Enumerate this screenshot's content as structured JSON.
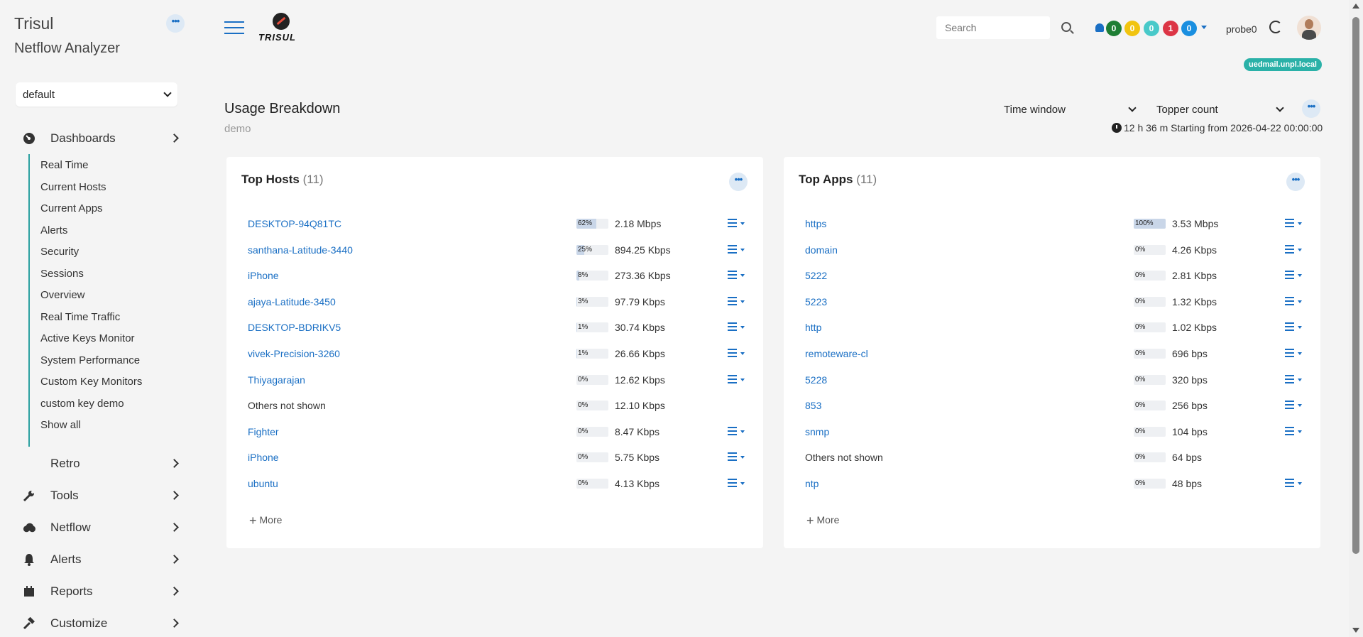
{
  "sidebar": {
    "brand": "Trisul",
    "subtitle": "Netflow Analyzer",
    "profile": "default",
    "nav": {
      "dashboards": {
        "label": "Dashboards",
        "icon": "dashboard-gauge-icon"
      },
      "retro": {
        "label": "Retro"
      },
      "tools": {
        "label": "Tools",
        "icon": "wrench-icon"
      },
      "netflow": {
        "label": "Netflow",
        "icon": "cloud-icon"
      },
      "alerts": {
        "label": "Alerts",
        "icon": "bell-icon"
      },
      "reports": {
        "label": "Reports",
        "icon": "calendar-icon"
      },
      "customize": {
        "label": "Customize",
        "icon": "hammer-icon"
      }
    },
    "dashboard_items": [
      "Real Time",
      "Current Hosts",
      "Current Apps",
      "Alerts",
      "Security",
      "Sessions",
      "Overview",
      "Real Time Traffic",
      "Active Keys Monitor",
      "System Performance",
      "Custom Key Monitors",
      "custom key demo",
      "Show all"
    ]
  },
  "header": {
    "logo_text": "TRISUL",
    "search_placeholder": "Search",
    "badges": [
      "0",
      "0",
      "0",
      "1",
      "0"
    ],
    "badge_colors": [
      "#1e7e34",
      "#f1c40f",
      "#48c9c9",
      "#dc3545",
      "#1a8fe0"
    ],
    "probe": "probe0",
    "host": "uedmail.unpl.local"
  },
  "page": {
    "title": "Usage Breakdown",
    "subtitle": "demo",
    "time_window_label": "Time window",
    "topper_count_label": "Topper count",
    "time_info": "12 h 36 m Starting from 2026-04-22 00:00:00"
  },
  "top_hosts": {
    "title": "Top Hosts",
    "count": "(11)",
    "more_label": "More",
    "rows": [
      {
        "name": "DESKTOP-94Q81TC",
        "pct": "62%",
        "fill": 0.62,
        "value": "2.18 Mbps",
        "link": true
      },
      {
        "name": "santhana-Latitude-3440",
        "pct": "25%",
        "fill": 0.25,
        "value": "894.25 Kbps",
        "link": true
      },
      {
        "name": "iPhone",
        "pct": "8%",
        "fill": 0.08,
        "value": "273.36 Kbps",
        "link": true
      },
      {
        "name": "ajaya-Latitude-3450",
        "pct": "3%",
        "fill": 0.03,
        "value": "97.79 Kbps",
        "link": true
      },
      {
        "name": "DESKTOP-BDRIKV5",
        "pct": "1%",
        "fill": 0.01,
        "value": "30.74 Kbps",
        "link": true
      },
      {
        "name": "vivek-Precision-3260",
        "pct": "1%",
        "fill": 0.01,
        "value": "26.66 Kbps",
        "link": true
      },
      {
        "name": "Thiyagarajan",
        "pct": "0%",
        "fill": 0.0,
        "value": "12.62 Kbps",
        "link": true
      },
      {
        "name": "Others not shown",
        "pct": "0%",
        "fill": 0.0,
        "value": "12.10 Kbps",
        "link": false
      },
      {
        "name": "Fighter",
        "pct": "0%",
        "fill": 0.0,
        "value": "8.47 Kbps",
        "link": true
      },
      {
        "name": "iPhone",
        "pct": "0%",
        "fill": 0.0,
        "value": "5.75 Kbps",
        "link": true
      },
      {
        "name": "ubuntu",
        "pct": "0%",
        "fill": 0.0,
        "value": "4.13 Kbps",
        "link": true
      }
    ]
  },
  "top_apps": {
    "title": "Top Apps",
    "count": "(11)",
    "more_label": "More",
    "rows": [
      {
        "name": "https",
        "pct": "100%",
        "fill": 1.0,
        "value": "3.53 Mbps",
        "link": true
      },
      {
        "name": "domain",
        "pct": "0%",
        "fill": 0.0,
        "value": "4.26 Kbps",
        "link": true
      },
      {
        "name": "5222",
        "pct": "0%",
        "fill": 0.0,
        "value": "2.81 Kbps",
        "link": true
      },
      {
        "name": "5223",
        "pct": "0%",
        "fill": 0.0,
        "value": "1.32 Kbps",
        "link": true
      },
      {
        "name": "http",
        "pct": "0%",
        "fill": 0.0,
        "value": "1.02 Kbps",
        "link": true
      },
      {
        "name": "remoteware-cl",
        "pct": "0%",
        "fill": 0.0,
        "value": "696 bps",
        "link": true
      },
      {
        "name": "5228",
        "pct": "0%",
        "fill": 0.0,
        "value": "320 bps",
        "link": true
      },
      {
        "name": "853",
        "pct": "0%",
        "fill": 0.0,
        "value": "256 bps",
        "link": true
      },
      {
        "name": "snmp",
        "pct": "0%",
        "fill": 0.0,
        "value": "104 bps",
        "link": true
      },
      {
        "name": "Others not shown",
        "pct": "0%",
        "fill": 0.0,
        "value": "64 bps",
        "link": false
      },
      {
        "name": "ntp",
        "pct": "0%",
        "fill": 0.0,
        "value": "48 bps",
        "link": true
      }
    ]
  }
}
